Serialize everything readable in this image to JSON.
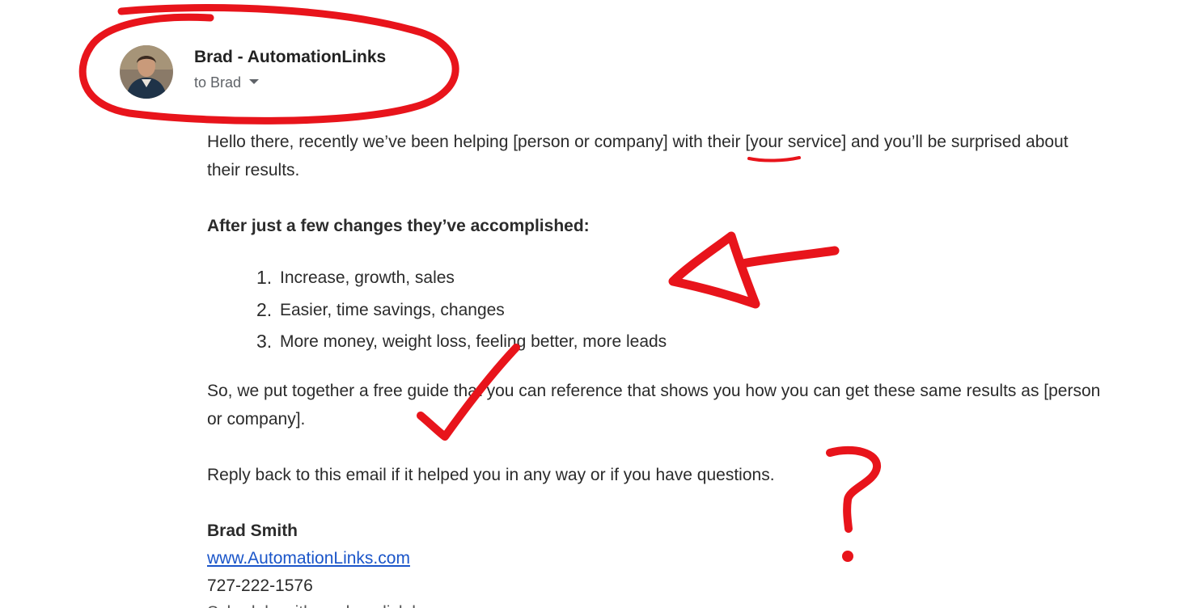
{
  "email": {
    "sender_name": "Brad - AutomationLinks",
    "recipient_label": "to Brad",
    "body": {
      "intro": "Hello there, recently we’ve been helping [person or company] with their [your service] and you’ll be surprised about their results.",
      "heading": "After just a few changes they’ve accomplished:",
      "list": [
        {
          "num": "1.",
          "text": "Increase, growth, sales"
        },
        {
          "num": "2.",
          "text": "Easier, time savings, changes"
        },
        {
          "num": "3.",
          "text": "More money, weight loss, feeling better, more leads"
        }
      ],
      "guide": "So, we put together a free guide that you can reference that shows you how you can get these same results as [person or company].",
      "reply": "Reply back to this email if it helped you in any way or if you have questions."
    },
    "signature": {
      "name": "Brad Smith",
      "website": "www.AutomationLinks.com",
      "phone": "727-222-1576",
      "cut_line": "Schedule with me hrs click here"
    }
  },
  "colors": {
    "annotation_red": "#e8141b",
    "link_blue": "#1a55c9",
    "text": "#2b2b2b"
  },
  "icons": {
    "recipient_dropdown": "caret-down-icon"
  }
}
